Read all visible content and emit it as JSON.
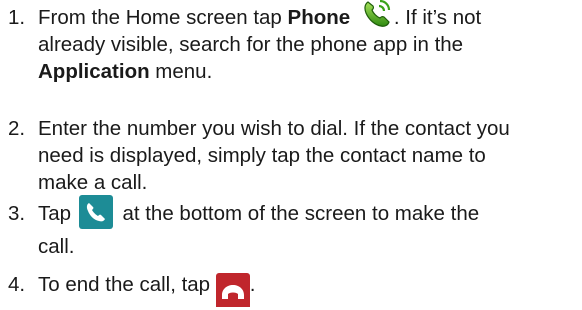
{
  "steps": [
    {
      "number": "1.",
      "text_a": "From the Home screen tap ",
      "bold_a": "Phone",
      "icon": "phone-app-icon",
      "text_b": ". If it’s not",
      "line2": "already visible, search for the phone app in the",
      "bold_b": "Application",
      "text_c": " menu."
    },
    {
      "number": "2.",
      "line1": "Enter the number you wish to dial. If the contact you",
      "line2": "need is displayed, simply tap the contact name to",
      "line3": "make a call."
    },
    {
      "number": "3.",
      "text_a": "Tap ",
      "icon": "call-button-icon",
      "text_b": " at the bottom of the screen to make the",
      "line2": "call."
    },
    {
      "number": "4.",
      "text_a": "To end the call, tap ",
      "icon": "end-call-icon",
      "text_b": "."
    }
  ],
  "colors": {
    "text": "#1a1a1a",
    "phone_icon_green": "#5cb01c",
    "call_button_teal": "#1d8c96",
    "end_call_red": "#c0262c"
  }
}
